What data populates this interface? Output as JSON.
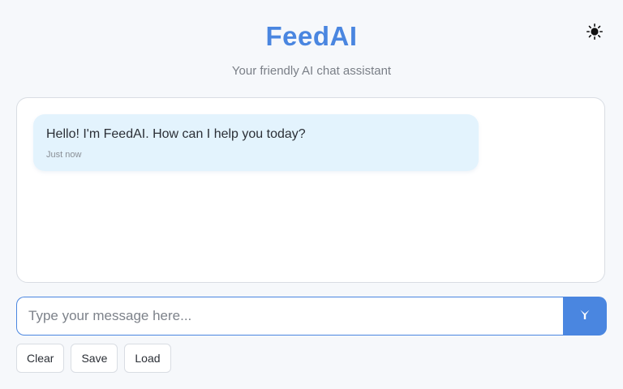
{
  "header": {
    "title": "FeedAI",
    "subtitle": "Your friendly AI chat assistant",
    "theme_icon": "sun-icon"
  },
  "chat": {
    "messages": [
      {
        "text": "Hello! I'm FeedAI. How can I help you today?",
        "time": "Just now"
      }
    ]
  },
  "composer": {
    "placeholder": "Type your message here...",
    "value": "",
    "send_icon": "send-icon"
  },
  "actions": {
    "clear_label": "Clear",
    "save_label": "Save",
    "load_label": "Load"
  },
  "colors": {
    "accent": "#4a86e0",
    "bubble_bg": "#e3f3fd",
    "page_bg": "#f6f8fb"
  }
}
